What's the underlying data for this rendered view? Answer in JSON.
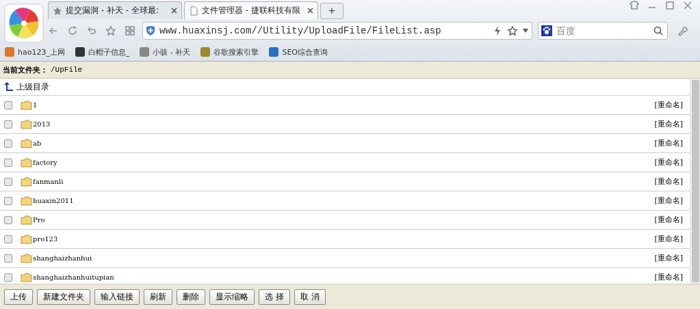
{
  "browser": {
    "tabs": [
      {
        "title": "提交漏洞 - 补天 - 全球最:",
        "selected": false
      },
      {
        "title": "文件管理器 - 捷联科技有限",
        "selected": true
      }
    ],
    "new_tab": "+",
    "address": "www.huaxinsj.com//Utility/UploadFile/FileList.asp",
    "search": {
      "placeholder": "百度"
    },
    "bookmarks": [
      "hao123_上网",
      "白帽子信息_",
      "小骇 - 补天",
      "谷歌搜索引擎",
      "SEO综合查询"
    ]
  },
  "current_folder": {
    "label": "当前文件夹：",
    "path": "/UpFile"
  },
  "parent_link": "上级目录",
  "files": [
    {
      "name": "1",
      "action": "[重命名]",
      "checked": false
    },
    {
      "name": "2013",
      "action": "[重命名]",
      "checked": false
    },
    {
      "name": "ab",
      "action": "[重命名]",
      "checked": false
    },
    {
      "name": "factory",
      "action": "[重命名]",
      "checked": false
    },
    {
      "name": "fanmanli",
      "action": "[重命名]",
      "checked": false
    },
    {
      "name": "huaxin2011",
      "action": "[重命名]",
      "checked": false
    },
    {
      "name": "Pro",
      "action": "[重命名]",
      "checked": false
    },
    {
      "name": "pro123",
      "action": "[重命名]",
      "checked": false
    },
    {
      "name": "shanghaizhanhui",
      "action": "[重命名]",
      "checked": false
    },
    {
      "name": "shanghaizhanhuitupian",
      "action": "[重命名]",
      "checked": false
    }
  ],
  "buttons": [
    "上传",
    "新建文件夹",
    "输入链接",
    "刷新",
    "删除",
    "显示缩略",
    "选 择",
    "取 消"
  ]
}
